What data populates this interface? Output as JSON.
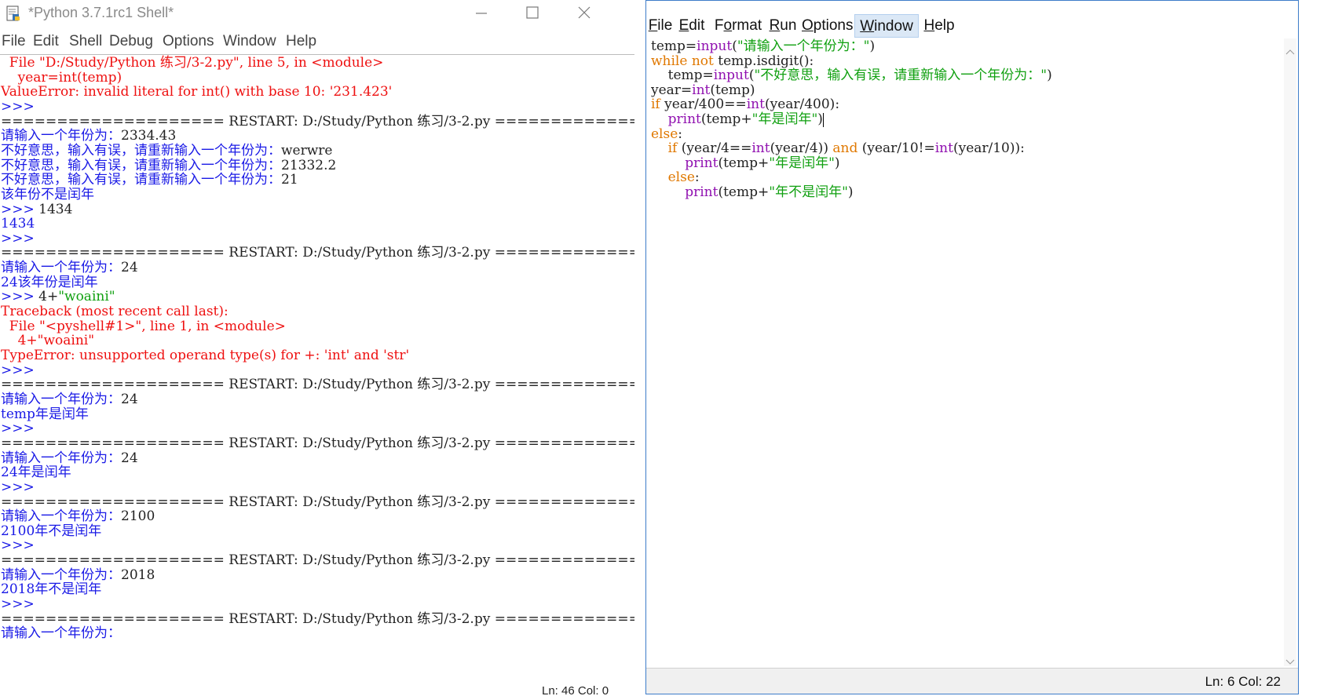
{
  "shell_window": {
    "title": "*Python 3.7.1rc1 Shell*",
    "menu": [
      "File",
      "Edit",
      "Shell",
      "Debug",
      "Options",
      "Window",
      "Help"
    ],
    "lines": [
      {
        "parts": [
          {
            "t": "  File \"D:/Study/Python 练习/3-2.py\", line 5, in <module>",
            "c": "r"
          }
        ]
      },
      {
        "parts": [
          {
            "t": "    year=int(temp)",
            "c": "r"
          }
        ]
      },
      {
        "parts": [
          {
            "t": "ValueError: invalid literal for int() with base 10: '231.423'",
            "c": "r"
          }
        ]
      },
      {
        "parts": [
          {
            "t": ">>> ",
            "c": "b"
          }
        ]
      },
      {
        "parts": [
          {
            "t": "==================== RESTART: D:/Study/Python 练习/3-2.py ====================",
            "c": "k"
          }
        ]
      },
      {
        "parts": [
          {
            "t": "请输入一个年份为：",
            "c": "b"
          },
          {
            "t": "2334.43",
            "c": "k"
          }
        ]
      },
      {
        "parts": [
          {
            "t": "不好意思，输入有误，请重新输入一个年份为：",
            "c": "b"
          },
          {
            "t": "werwre",
            "c": "k"
          }
        ]
      },
      {
        "parts": [
          {
            "t": "不好意思，输入有误，请重新输入一个年份为：",
            "c": "b"
          },
          {
            "t": "21332.2",
            "c": "k"
          }
        ]
      },
      {
        "parts": [
          {
            "t": "不好意思，输入有误，请重新输入一个年份为：",
            "c": "b"
          },
          {
            "t": "21",
            "c": "k"
          }
        ]
      },
      {
        "parts": [
          {
            "t": "该年份不是闰年",
            "c": "b"
          }
        ]
      },
      {
        "parts": [
          {
            "t": ">>> ",
            "c": "b"
          },
          {
            "t": "1434",
            "c": "k"
          }
        ]
      },
      {
        "parts": [
          {
            "t": "1434",
            "c": "b"
          }
        ]
      },
      {
        "parts": [
          {
            "t": ">>> ",
            "c": "b"
          }
        ]
      },
      {
        "parts": [
          {
            "t": "==================== RESTART: D:/Study/Python 练习/3-2.py ====================",
            "c": "k"
          }
        ]
      },
      {
        "parts": [
          {
            "t": "请输入一个年份为：",
            "c": "b"
          },
          {
            "t": "24",
            "c": "k"
          }
        ]
      },
      {
        "parts": [
          {
            "t": "24该年份是闰年",
            "c": "b"
          }
        ]
      },
      {
        "parts": [
          {
            "t": ">>> ",
            "c": "b"
          },
          {
            "t": "4+",
            "c": "k"
          },
          {
            "t": "\"woaini\"",
            "c": "g"
          }
        ]
      },
      {
        "parts": [
          {
            "t": "Traceback (most recent call last):",
            "c": "r"
          }
        ]
      },
      {
        "parts": [
          {
            "t": "  File \"<pyshell#1>\", line 1, in <module>",
            "c": "r"
          }
        ]
      },
      {
        "parts": [
          {
            "t": "    4+\"woaini\"",
            "c": "r"
          }
        ]
      },
      {
        "parts": [
          {
            "t": "TypeError: unsupported operand type(s) for +: 'int' and 'str'",
            "c": "r"
          }
        ]
      },
      {
        "parts": [
          {
            "t": ">>> ",
            "c": "b"
          }
        ]
      },
      {
        "parts": [
          {
            "t": "==================== RESTART: D:/Study/Python 练习/3-2.py ====================",
            "c": "k"
          }
        ]
      },
      {
        "parts": [
          {
            "t": "请输入一个年份为：",
            "c": "b"
          },
          {
            "t": "24",
            "c": "k"
          }
        ]
      },
      {
        "parts": [
          {
            "t": "temp年是闰年",
            "c": "b"
          }
        ]
      },
      {
        "parts": [
          {
            "t": ">>> ",
            "c": "b"
          }
        ]
      },
      {
        "parts": [
          {
            "t": "==================== RESTART: D:/Study/Python 练习/3-2.py ====================",
            "c": "k"
          }
        ]
      },
      {
        "parts": [
          {
            "t": "请输入一个年份为：",
            "c": "b"
          },
          {
            "t": "24",
            "c": "k"
          }
        ]
      },
      {
        "parts": [
          {
            "t": "24年是闰年",
            "c": "b"
          }
        ]
      },
      {
        "parts": [
          {
            "t": ">>> ",
            "c": "b"
          }
        ]
      },
      {
        "parts": [
          {
            "t": "==================== RESTART: D:/Study/Python 练习/3-2.py ====================",
            "c": "k"
          }
        ]
      },
      {
        "parts": [
          {
            "t": "请输入一个年份为：",
            "c": "b"
          },
          {
            "t": "2100",
            "c": "k"
          }
        ]
      },
      {
        "parts": [
          {
            "t": "2100年不是闰年",
            "c": "b"
          }
        ]
      },
      {
        "parts": [
          {
            "t": ">>> ",
            "c": "b"
          }
        ]
      },
      {
        "parts": [
          {
            "t": "==================== RESTART: D:/Study/Python 练习/3-2.py ====================",
            "c": "k"
          }
        ]
      },
      {
        "parts": [
          {
            "t": "请输入一个年份为：",
            "c": "b"
          },
          {
            "t": "2018",
            "c": "k"
          }
        ]
      },
      {
        "parts": [
          {
            "t": "2018年不是闰年",
            "c": "b"
          }
        ]
      },
      {
        "parts": [
          {
            "t": ">>> ",
            "c": "b"
          }
        ]
      },
      {
        "parts": [
          {
            "t": "==================== RESTART: D:/Study/Python 练习/3-2.py ====================",
            "c": "k"
          }
        ]
      },
      {
        "parts": [
          {
            "t": "请输入一个年份为：",
            "c": "b"
          }
        ]
      }
    ],
    "status": "Ln: 46  Col: 0"
  },
  "editor_window": {
    "menu": [
      {
        "label": "File",
        "ul": 0
      },
      {
        "label": "Edit",
        "ul": 0
      },
      {
        "label": "Format",
        "ul": 1
      },
      {
        "label": "Run",
        "ul": 0
      },
      {
        "label": "Options",
        "ul": 0
      },
      {
        "label": "Window",
        "ul": 0,
        "active": true
      },
      {
        "label": "Help",
        "ul": 0
      }
    ],
    "code": [
      {
        "parts": [
          {
            "t": "temp=",
            "c": "k"
          },
          {
            "t": "input",
            "c": "p"
          },
          {
            "t": "(",
            "c": "k"
          },
          {
            "t": "\"请输入一个年份为：\"",
            "c": "g"
          },
          {
            "t": ")",
            "c": "k"
          }
        ]
      },
      {
        "parts": [
          {
            "t": "while not ",
            "c": "o"
          },
          {
            "t": "temp.isdigit():",
            "c": "k"
          }
        ]
      },
      {
        "parts": [
          {
            "t": "    temp=",
            "c": "k"
          },
          {
            "t": "input",
            "c": "p"
          },
          {
            "t": "(",
            "c": "k"
          },
          {
            "t": "\"不好意思，输入有误，请重新输入一个年份为：\"",
            "c": "g"
          },
          {
            "t": ")",
            "c": "k"
          }
        ]
      },
      {
        "parts": [
          {
            "t": "year=",
            "c": "k"
          },
          {
            "t": "int",
            "c": "p"
          },
          {
            "t": "(temp)",
            "c": "k"
          }
        ]
      },
      {
        "parts": [
          {
            "t": "if ",
            "c": "o"
          },
          {
            "t": "year/400==",
            "c": "k"
          },
          {
            "t": "int",
            "c": "p"
          },
          {
            "t": "(year/400):",
            "c": "k"
          }
        ]
      },
      {
        "parts": [
          {
            "t": "    ",
            "c": "k"
          },
          {
            "t": "print",
            "c": "p"
          },
          {
            "t": "(temp+",
            "c": "k"
          },
          {
            "t": "\"年是闰年\"",
            "c": "g"
          },
          {
            "t": ")",
            "c": "k"
          }
        ],
        "caret": true
      },
      {
        "parts": [
          {
            "t": "else",
            "c": "o"
          },
          {
            "t": ":",
            "c": "k"
          }
        ]
      },
      {
        "parts": [
          {
            "t": "    ",
            "c": "k"
          },
          {
            "t": "if ",
            "c": "o"
          },
          {
            "t": "(year/4==",
            "c": "k"
          },
          {
            "t": "int",
            "c": "p"
          },
          {
            "t": "(year/4)) ",
            "c": "k"
          },
          {
            "t": "and ",
            "c": "o"
          },
          {
            "t": "(year/10!=",
            "c": "k"
          },
          {
            "t": "int",
            "c": "p"
          },
          {
            "t": "(year/10)):",
            "c": "k"
          }
        ]
      },
      {
        "parts": [
          {
            "t": "        ",
            "c": "k"
          },
          {
            "t": "print",
            "c": "p"
          },
          {
            "t": "(temp+",
            "c": "k"
          },
          {
            "t": "\"年是闰年\"",
            "c": "g"
          },
          {
            "t": ")",
            "c": "k"
          }
        ]
      },
      {
        "parts": [
          {
            "t": "    ",
            "c": "k"
          },
          {
            "t": "else",
            "c": "o"
          },
          {
            "t": ":",
            "c": "k"
          }
        ]
      },
      {
        "parts": [
          {
            "t": "        ",
            "c": "k"
          },
          {
            "t": "print",
            "c": "p"
          },
          {
            "t": "(temp+",
            "c": "k"
          },
          {
            "t": "\"年不是闰年\"",
            "c": "g"
          },
          {
            "t": ")",
            "c": "k"
          }
        ]
      }
    ],
    "status": "Ln: 6  Col: 22"
  },
  "icons": [
    "python-file-icon",
    "minimize-icon",
    "maximize-icon",
    "close-icon",
    "scroll-up-arrow-icon",
    "scroll-down-arrow-icon"
  ]
}
